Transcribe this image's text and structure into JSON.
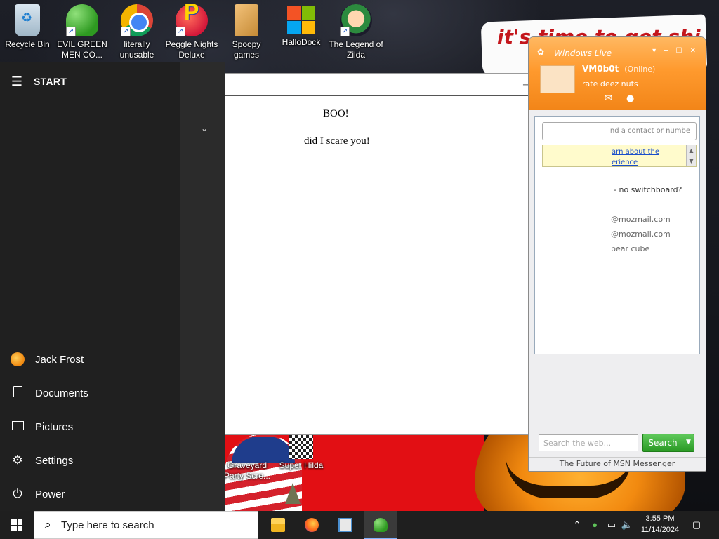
{
  "desktop": {
    "icons": [
      {
        "label": "Recycle Bin",
        "icon": "recycle-bin-icon"
      },
      {
        "label": "EVIL GREEN MEN CO...",
        "icon": "msn-people-icon"
      },
      {
        "label": "literally unusable",
        "icon": "chrome-icon"
      },
      {
        "label": "Peggle Nights Deluxe",
        "icon": "peggle-icon"
      },
      {
        "label": "Spoopy games",
        "icon": "spoopy-folder-icon"
      },
      {
        "label": "HalloDock",
        "icon": "windows-logo-icon"
      },
      {
        "label": "The Legend of Zilda",
        "icon": "zilda-icon"
      },
      {
        "label": "Graveyard Party Scre...",
        "icon": "graveyard-icon"
      },
      {
        "label": "Super Hilda",
        "icon": "super-hilda-icon"
      }
    ],
    "poster_text": "it's time to get shit and"
  },
  "start_menu": {
    "title": "START",
    "items": [
      {
        "label": "Jack Frost",
        "icon": "user-avatar-icon"
      },
      {
        "label": "Documents",
        "icon": "document-icon"
      },
      {
        "label": "Pictures",
        "icon": "pictures-icon"
      },
      {
        "label": "Settings",
        "icon": "gear-icon"
      },
      {
        "label": "Power",
        "icon": "power-icon"
      }
    ]
  },
  "browser_window": {
    "heading": "BOO!",
    "body": "did I scare you!"
  },
  "messenger": {
    "brand": "Windows Live",
    "user_name": "VM0b0t",
    "user_status": "(Online)",
    "personal_message": "rate deez nuts",
    "find_placeholder": "nd a contact or numbe",
    "info_line1": "arn about the",
    "info_line2": "erience",
    "group_label": "- no switchboard?",
    "contacts": [
      "@mozmail.com",
      "@mozmail.com",
      "bear cube"
    ],
    "search_placeholder": "Search the web...",
    "search_button": "Search",
    "footer": "The Future of MSN Messenger",
    "colors": {
      "header": "#ff9a2e",
      "search_button": "#2a9a24"
    }
  },
  "taskbar": {
    "search_placeholder": "Type here to search",
    "apps": [
      "file-explorer-icon",
      "firefox-icon",
      "news-icon",
      "msn-messenger-icon"
    ],
    "time": "3:55 PM",
    "date": "11/14/2024"
  }
}
